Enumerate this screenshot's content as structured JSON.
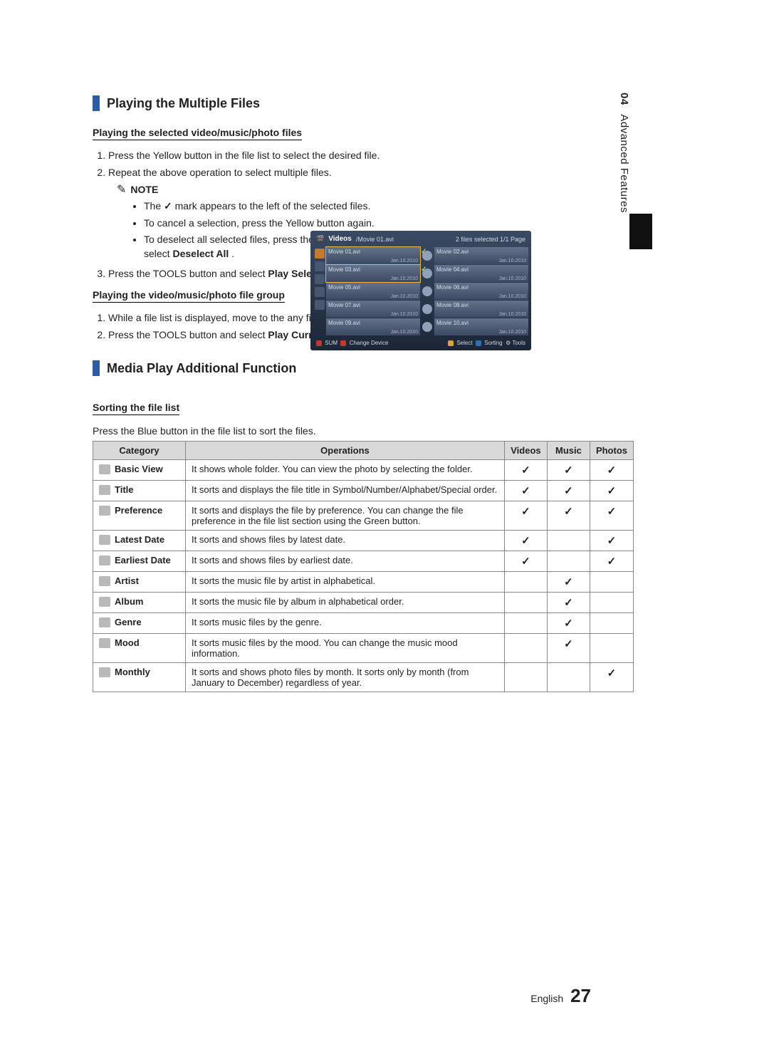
{
  "sidebar": {
    "chapter_num": "04",
    "chapter_title": "Advanced Features"
  },
  "heading1": "Playing the Multiple Files",
  "sub1": "Playing the selected video/music/photo files",
  "steps1": {
    "s1": "Press the Yellow button in the file list to select the desired file.",
    "s2": "Repeat the above operation to select multiple files.",
    "s3_pre": "Press the TOOLS button and select ",
    "s3_bold": "Play Selected Contents",
    "s3_post": "."
  },
  "note_label": "NOTE",
  "note": {
    "n1_pre": "The ",
    "n1_post": " mark appears to the left of the selected files.",
    "n2": "To cancel a selection, press the Yellow button again.",
    "n3_pre": "To deselect all selected files, press the TOOLS button and select ",
    "n3_bold": "Deselect All",
    "n3_post": "."
  },
  "sub2": "Playing the video/music/photo file group",
  "steps2": {
    "s1": "While a file list is displayed, move to the any file in desired group.",
    "s2_pre": "Press the TOOLS button and select ",
    "s2_bold": "Play Current Group",
    "s2_post": "."
  },
  "heading2": "Media Play Additional Function",
  "sort_title": "Sorting the file list",
  "sort_desc": "Press the Blue button in the file list to sort the files.",
  "table": {
    "h_category": "Category",
    "h_operations": "Operations",
    "h_videos": "Videos",
    "h_music": "Music",
    "h_photos": "Photos",
    "rows": [
      {
        "cat": "Basic View",
        "op": "It shows whole folder. You can view the photo by selecting the folder.",
        "v": true,
        "m": true,
        "p": true
      },
      {
        "cat": "Title",
        "op": "It sorts and displays the file title in Symbol/Number/Alphabet/Special order.",
        "v": true,
        "m": true,
        "p": true
      },
      {
        "cat": "Preference",
        "op": "It sorts and displays the file by preference. You can change the file preference in the file list section using the Green button.",
        "v": true,
        "m": true,
        "p": true
      },
      {
        "cat": "Latest Date",
        "op": "It sorts and shows files by latest date.",
        "v": true,
        "m": false,
        "p": true
      },
      {
        "cat": "Earliest Date",
        "op": "It sorts and shows files by earliest date.",
        "v": true,
        "m": false,
        "p": true
      },
      {
        "cat": "Artist",
        "op": "It sorts the music file by artist in alphabetical.",
        "v": false,
        "m": true,
        "p": false
      },
      {
        "cat": "Album",
        "op": "It sorts the music file by album in alphabetical order.",
        "v": false,
        "m": true,
        "p": false
      },
      {
        "cat": "Genre",
        "op": "It sorts music files by the genre.",
        "v": false,
        "m": true,
        "p": false
      },
      {
        "cat": "Mood",
        "op": "It sorts music files by the mood. You can change the music mood information.",
        "v": false,
        "m": true,
        "p": false
      },
      {
        "cat": "Monthly",
        "op": "It sorts and shows photo files by month. It sorts only by month (from January to December) regardless of year.",
        "v": false,
        "m": false,
        "p": true
      }
    ]
  },
  "tv": {
    "title": "Videos",
    "crumb": "/Movie 01.avi",
    "status": "2 files selected   1/1 Page",
    "files": [
      {
        "name": "Movie 01.avi",
        "date": "Jan.10.2010",
        "sel": true
      },
      {
        "name": "Movie 02.avi",
        "date": "Jan.10.2010",
        "sel": false
      },
      {
        "name": "Movie 03.avi",
        "date": "Jan.10.2010",
        "sel": true
      },
      {
        "name": "Movie 04.avi",
        "date": "Jan.10.2010",
        "sel": false
      },
      {
        "name": "Movie 05.avi",
        "date": "Jan.10.2010",
        "sel": false
      },
      {
        "name": "Movie 06.avi",
        "date": "Jan.10.2010",
        "sel": false
      },
      {
        "name": "Movie 07.avi",
        "date": "Jan.10.2010",
        "sel": false
      },
      {
        "name": "Movie 08.avi",
        "date": "Jan.10.2010",
        "sel": false
      },
      {
        "name": "Movie 09.avi",
        "date": "Jan.10.2010",
        "sel": false
      },
      {
        "name": "Movie 10.avi",
        "date": "Jan.10.2010",
        "sel": false
      }
    ],
    "foot_left_label": "SUM",
    "foot_left_action": "Change Device",
    "foot_select": "Select",
    "foot_sorting": "Sorting",
    "foot_tools": "Tools"
  },
  "footer": {
    "lang": "English",
    "page": "27"
  }
}
